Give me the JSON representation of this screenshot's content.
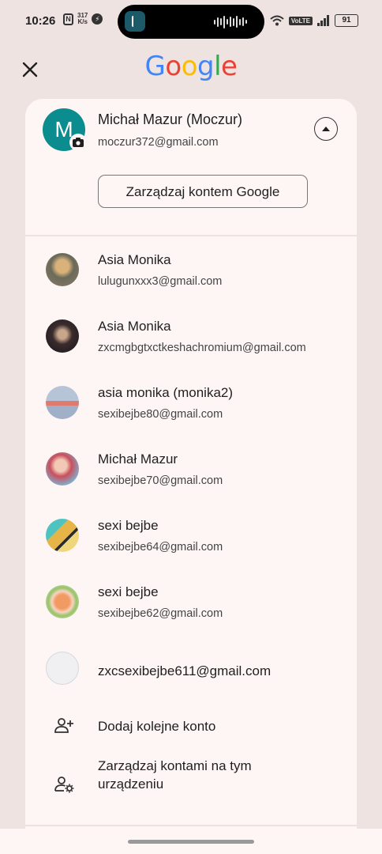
{
  "status_bar": {
    "time": "10:26",
    "nfc": "N",
    "speed_value": "317",
    "speed_unit": "K/s",
    "volte": "VoLTE",
    "battery": "91"
  },
  "header": {
    "close_icon": "close-icon",
    "logo_text": [
      "G",
      "o",
      "o",
      "g",
      "l",
      "e"
    ],
    "logo_colors": [
      "#4285F4",
      "#EA4335",
      "#FBBC05",
      "#4285F4",
      "#34A853",
      "#EA4335"
    ]
  },
  "primary_account": {
    "avatar_letter": "M",
    "avatar_color": "#0b8c8f",
    "name": "Michał Mazur (Moczur)",
    "email": "moczur372@gmail.com",
    "manage_button": "Zarządzaj kontem Google"
  },
  "accounts": [
    {
      "name": "Asia Monika",
      "email": "lulugunxxx3@gmail.com",
      "avatar": "photo"
    },
    {
      "name": "Asia Monika",
      "email": "zxcmgbgtxctkeshachromium@gmail.com",
      "avatar": "photo"
    },
    {
      "name": "asia monika (monika2)",
      "email": "sexibejbe80@gmail.com",
      "avatar": "photo"
    },
    {
      "name": "Michał Mazur",
      "email": "sexibejbe70@gmail.com",
      "avatar": "photo"
    },
    {
      "name": "sexi bejbe",
      "email": "sexibejbe64@gmail.com",
      "avatar": "photo"
    },
    {
      "name": "sexi bejbe",
      "email": "sexibejbe62@gmail.com",
      "avatar": "photo"
    },
    {
      "name": "zxcsexibejbe611@gmail.com",
      "email": "",
      "avatar": "blank"
    }
  ],
  "actions": {
    "add_account": "Dodaj kolejne konto",
    "manage_accounts": "Zarządzaj kontami na tym urządzeniu"
  }
}
